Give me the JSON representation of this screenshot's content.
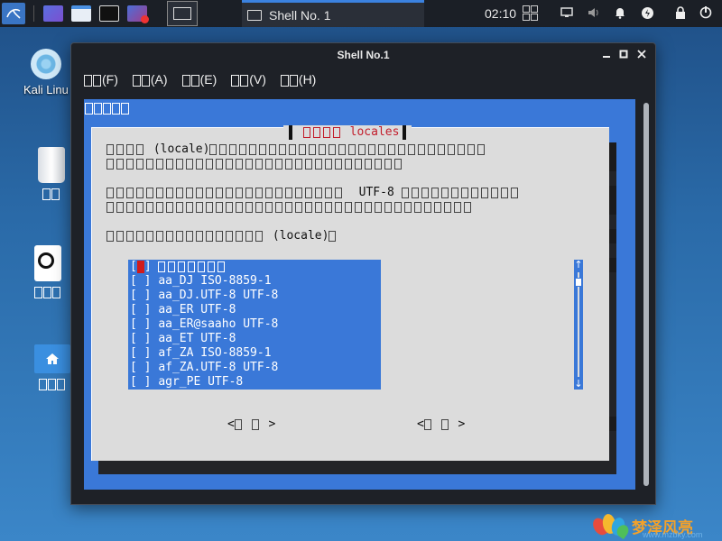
{
  "taskbar": {
    "task_title": "Shell No. 1",
    "clock": "02:10"
  },
  "desktop": {
    "icons": [
      {
        "label": "Kali Linu",
        "icon": "kali-disc-icon"
      },
      {
        "label": "",
        "icon": "trash-icon"
      },
      {
        "label": "",
        "icon": "drive-icon"
      },
      {
        "label": "",
        "icon": "home-folder-icon"
      }
    ]
  },
  "window": {
    "title": "Shell No.1",
    "menu": [
      "(F)",
      "(A)",
      "(E)",
      "(V)",
      "(H)"
    ]
  },
  "dialog": {
    "title": "locales",
    "line1_word": "(locale)",
    "line3_word": "UTF-8",
    "line5_word": "(locale)",
    "locales": [
      "aa_DJ ISO-8859-1",
      "aa_DJ.UTF-8 UTF-8",
      "aa_ER UTF-8",
      "aa_ER@saaho UTF-8",
      "aa_ET UTF-8",
      "af_ZA ISO-8859-1",
      "af_ZA.UTF-8 UTF-8",
      "agr_PE UTF-8"
    ],
    "checkbox_empty": "[ ]",
    "button_gt": ">",
    "button_lt": "<"
  },
  "watermark": {
    "text": "梦泽风亮",
    "url": "www.mzbky.com"
  },
  "colors": {
    "terminal_bg": "#3a78d8",
    "dialog_bg": "#dcdcdc",
    "title_red": "#c21c2a",
    "taskbar": "#1b1f26"
  }
}
